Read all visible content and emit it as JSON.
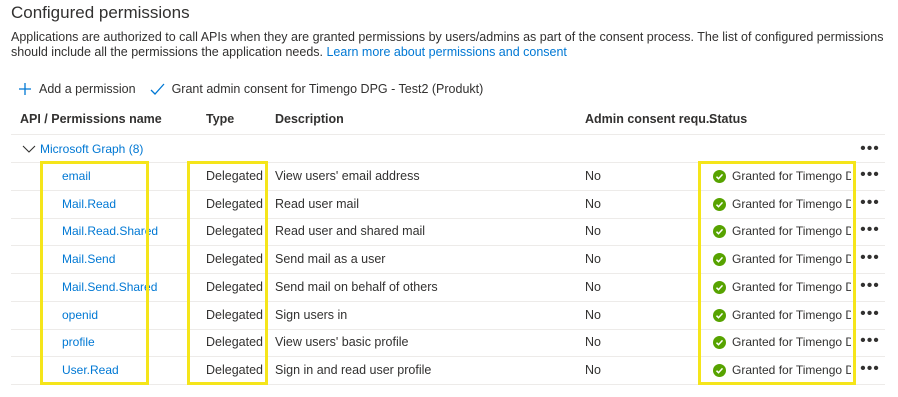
{
  "page": {
    "title": "Configured permissions",
    "description": "Applications are authorized to call APIs when they are granted permissions by users/admins as part of the consent process. The list of configured permissions should include all the permissions the application needs.",
    "learn_more": "Learn more about permissions and consent"
  },
  "toolbar": {
    "add_label": "Add a permission",
    "grant_label": "Grant admin consent for Timengo DPG - Test2 (Produkt)"
  },
  "table": {
    "headers": {
      "name": "API / Permissions name",
      "type": "Type",
      "description": "Description",
      "admin": "Admin consent requ...",
      "status": "Status"
    },
    "group_label": "Microsoft Graph (8)",
    "more_glyph": "•••",
    "rows": [
      {
        "name": "email",
        "type": "Delegated",
        "description": "View users' email address",
        "admin": "No",
        "status": "Granted for Timengo D..."
      },
      {
        "name": "Mail.Read",
        "type": "Delegated",
        "description": "Read user mail",
        "admin": "No",
        "status": "Granted for Timengo D..."
      },
      {
        "name": "Mail.Read.Shared",
        "type": "Delegated",
        "description": "Read user and shared mail",
        "admin": "No",
        "status": "Granted for Timengo D..."
      },
      {
        "name": "Mail.Send",
        "type": "Delegated",
        "description": "Send mail as a user",
        "admin": "No",
        "status": "Granted for Timengo D..."
      },
      {
        "name": "Mail.Send.Shared",
        "type": "Delegated",
        "description": "Send mail on behalf of others",
        "admin": "No",
        "status": "Granted for Timengo D..."
      },
      {
        "name": "openid",
        "type": "Delegated",
        "description": "Sign users in",
        "admin": "No",
        "status": "Granted for Timengo D..."
      },
      {
        "name": "profile",
        "type": "Delegated",
        "description": "View users' basic profile",
        "admin": "No",
        "status": "Granted for Timengo D..."
      },
      {
        "name": "User.Read",
        "type": "Delegated",
        "description": "Sign in and read user profile",
        "admin": "No",
        "status": "Granted for Timengo D..."
      }
    ]
  },
  "colors": {
    "accent": "#0078d4",
    "granted": "#57a300",
    "highlight": "#f5e51a"
  }
}
